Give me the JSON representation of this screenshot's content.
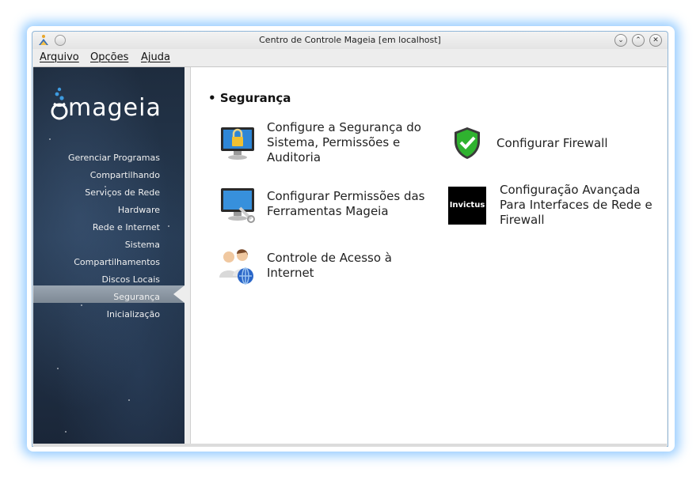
{
  "window": {
    "title": "Centro de Controle Mageia  [em localhost]"
  },
  "menubar": {
    "items": [
      "Arquivo",
      "Opções",
      "Ajuda"
    ]
  },
  "sidebar": {
    "logo": "mageia",
    "items": [
      {
        "label": "Gerenciar Programas",
        "active": false
      },
      {
        "label": "Compartilhando",
        "active": false
      },
      {
        "label": "Serviços de Rede",
        "active": false
      },
      {
        "label": "Hardware",
        "active": false
      },
      {
        "label": "Rede e Internet",
        "active": false
      },
      {
        "label": "Sistema",
        "active": false
      },
      {
        "label": "Compartilhamentos",
        "active": false
      },
      {
        "label": "Discos Locais",
        "active": false
      },
      {
        "label": "Segurança",
        "active": true
      },
      {
        "label": "Inicialização",
        "active": false
      }
    ]
  },
  "content": {
    "section_title": "Segurança",
    "tools": [
      {
        "label": "Configure a Segurança do Sistema, Permissões e Auditoria",
        "icon": "monitor-lock-icon"
      },
      {
        "label": "Configurar Firewall",
        "icon": "shield-check-icon"
      },
      {
        "label": "Configurar Permissões das Ferramentas Mageia",
        "icon": "monitor-tools-icon"
      },
      {
        "label": "Configuração Avançada Para Interfaces de Rede e Firewall",
        "icon": "invictus-logo-icon",
        "icon_text": "Invictus"
      },
      {
        "label": "Controle de Acesso à Internet",
        "icon": "users-globe-icon"
      }
    ]
  }
}
